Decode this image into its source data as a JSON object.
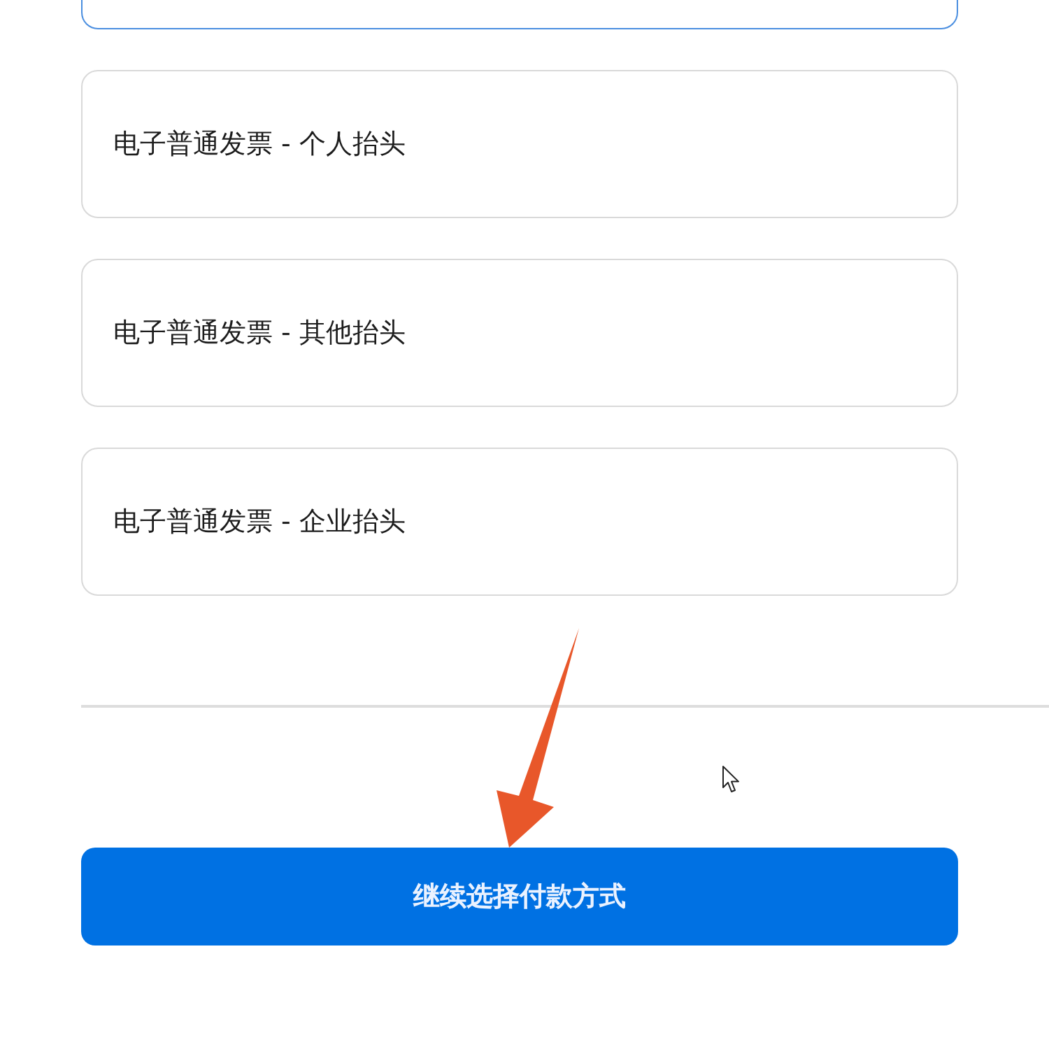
{
  "options": [
    {
      "selected": true
    },
    {
      "label": "电子普通发票 - 个人抬头",
      "selected": false
    },
    {
      "label": "电子普通发票 - 其他抬头",
      "selected": false
    },
    {
      "label": "电子普通发票 - 企业抬头",
      "selected": false
    }
  ],
  "continue_button": {
    "label": "继续选择付款方式"
  }
}
